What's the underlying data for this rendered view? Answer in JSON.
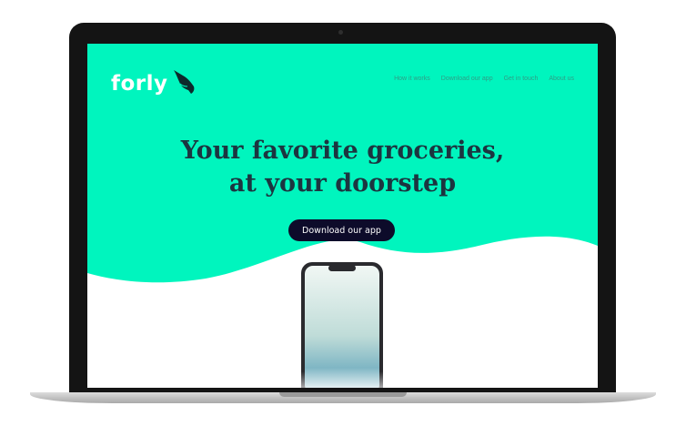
{
  "brand": {
    "name": "forly",
    "logo_icon": "bird-icon"
  },
  "nav": {
    "items": [
      {
        "label": "How it works"
      },
      {
        "label": "Download our app"
      },
      {
        "label": "Get in touch"
      },
      {
        "label": "About us"
      }
    ]
  },
  "hero": {
    "headline_line1": "Your favorite groceries,",
    "headline_line2": "at your doorstep",
    "cta_label": "Download our app"
  },
  "colors": {
    "hero_background": "#00f5be",
    "cta_background": "#0d0b2a",
    "headline_text": "#1c3540",
    "device_frame": "#141414"
  }
}
